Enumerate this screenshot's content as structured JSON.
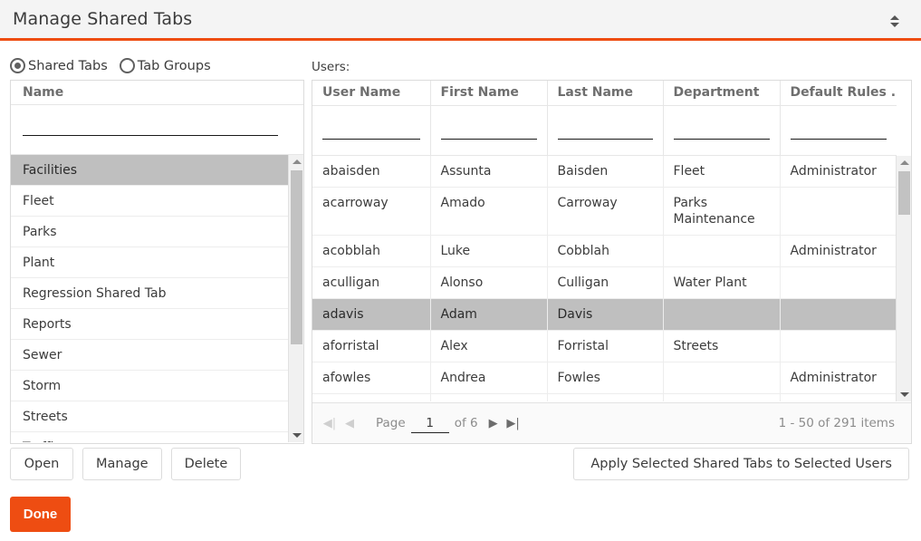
{
  "window": {
    "title": "Manage Shared Tabs",
    "collapse_icon": "chevron-up-down-icon",
    "accent_color": "#ee4d12",
    "titlebar_bg": "#f4f4f4"
  },
  "mode_selector": {
    "options": [
      {
        "label": "Shared Tabs",
        "selected": true
      },
      {
        "label": "Tab Groups",
        "selected": false
      }
    ]
  },
  "left_panel": {
    "column_header": "Name",
    "filter_value": "",
    "filter_placeholder": "",
    "items": [
      {
        "label": "Facilities",
        "selected": true
      },
      {
        "label": "Fleet",
        "selected": false
      },
      {
        "label": "Parks",
        "selected": false
      },
      {
        "label": "Plant",
        "selected": false
      },
      {
        "label": "Regression Shared Tab",
        "selected": false
      },
      {
        "label": "Reports",
        "selected": false
      },
      {
        "label": "Sewer",
        "selected": false
      },
      {
        "label": "Storm",
        "selected": false
      },
      {
        "label": "Streets",
        "selected": false
      },
      {
        "label": "Traffic",
        "selected": false
      }
    ],
    "scrollbar": {
      "up_icon": "triangle-up-icon",
      "down_icon": "triangle-down-icon"
    }
  },
  "users_panel": {
    "label": "Users:",
    "columns": [
      "User Name",
      "First Name",
      "Last Name",
      "Department",
      "Default Rules ..."
    ],
    "filters": [
      "",
      "",
      "",
      "",
      ""
    ],
    "rows": [
      {
        "cells": [
          "abaisden",
          "Assunta",
          "Baisden",
          "Fleet",
          "Administrator"
        ],
        "selected": false
      },
      {
        "cells": [
          "acarroway",
          "Amado",
          "Carroway",
          "Parks Maintenance",
          ""
        ],
        "selected": false
      },
      {
        "cells": [
          "acobblah",
          "Luke",
          "Cobblah",
          "",
          "Administrator"
        ],
        "selected": false
      },
      {
        "cells": [
          "aculligan",
          "Alonso",
          "Culligan",
          "Water Plant",
          ""
        ],
        "selected": false
      },
      {
        "cells": [
          "adavis",
          "Adam",
          "Davis",
          "",
          ""
        ],
        "selected": true
      },
      {
        "cells": [
          "aforristal",
          "Alex",
          "Forristal",
          "Streets",
          ""
        ],
        "selected": false
      },
      {
        "cells": [
          "afowles",
          "Andrea",
          "Fowles",
          "",
          "Administrator"
        ],
        "selected": false
      },
      {
        "cells": [
          "",
          "",
          "",
          "",
          ""
        ],
        "selected": false
      }
    ],
    "pager": {
      "first_icon": "go-to-first-page-icon",
      "prev_icon": "previous-page-icon",
      "next_icon": "next-page-icon",
      "last_icon": "go-to-last-page-icon",
      "page_label": "Page",
      "page_value": "1",
      "of_label": "of 6",
      "items_summary": "1 - 50 of 291 items"
    },
    "scrollbar": {
      "up_icon": "triangle-up-icon",
      "down_icon": "triangle-down-icon"
    }
  },
  "actions": {
    "open": "Open",
    "manage": "Manage",
    "delete": "Delete",
    "apply": "Apply Selected Shared Tabs to Selected Users",
    "done": "Done"
  }
}
